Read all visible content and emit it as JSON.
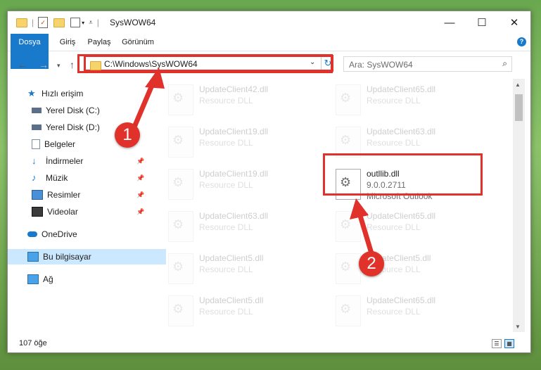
{
  "window": {
    "title": "SysWOW64"
  },
  "ribbon": {
    "tabs": [
      "Dosya",
      "Giriş",
      "Paylaş",
      "Görünüm"
    ]
  },
  "address": {
    "path": "C:\\Windows\\SysWOW64"
  },
  "search": {
    "placeholder": "Ara: SysWOW64"
  },
  "sidebar": {
    "items": [
      {
        "label": "Hızlı erişim"
      },
      {
        "label": "Yerel Disk (C:)"
      },
      {
        "label": "Yerel Disk (D:)"
      },
      {
        "label": "Belgeler"
      },
      {
        "label": "İndirmeler"
      },
      {
        "label": "Müzik"
      },
      {
        "label": "Resimler"
      },
      {
        "label": "Videolar"
      },
      {
        "label": "OneDrive"
      },
      {
        "label": "Bu bilgisayar"
      },
      {
        "label": "Ağ"
      }
    ]
  },
  "files": {
    "left": [
      {
        "name": "UpdateClient42.dll",
        "type": "Resource DLL"
      },
      {
        "name": "UpdateClient19.dll",
        "type": "Resource DLL"
      },
      {
        "name": "UpdateClient19.dll",
        "type": "Resource DLL"
      },
      {
        "name": "UpdateClient63.dll",
        "type": "Resource DLL"
      },
      {
        "name": "UpdateClient5.dll",
        "type": "Resource DLL"
      },
      {
        "name": "UpdateClient5.dll",
        "type": "Resource DLL"
      }
    ],
    "right": [
      {
        "name": "UpdateClient65.dll",
        "type": "Resource DLL"
      },
      {
        "name": "UpdateClient63.dll",
        "type": "Resource DLL"
      },
      {
        "name": "UpdateClient65.dll",
        "type": "Resource DLL"
      },
      {
        "name": "UpdateClient5.dll",
        "type": "Resource DLL"
      },
      {
        "name": "UpdateClient65.dll",
        "type": "Resource DLL"
      }
    ],
    "highlighted": {
      "name": "outllib.dll",
      "version": "9.0.0.2711",
      "company": "Microsoft Outlook"
    }
  },
  "status": {
    "count": "107 öğe"
  },
  "annotations": {
    "step1": "1",
    "step2": "2",
    "color": "#e0312b"
  }
}
